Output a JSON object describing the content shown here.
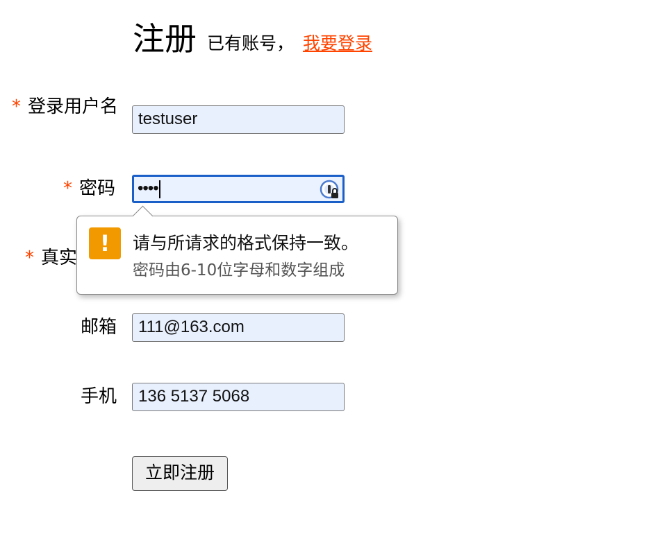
{
  "header": {
    "title": "注册",
    "subtitle": "已有账号，",
    "login_link": "我要登录"
  },
  "form": {
    "username_label": "登录用户名",
    "username_value": "testuser",
    "password_label": "密码",
    "password_value": "••••",
    "realname_label_partial": "真实",
    "email_label": "邮箱",
    "email_value": "111@163.com",
    "phone_label": "手机",
    "phone_value": "136 5137 5068",
    "required_mark": "*",
    "submit_label": "立即注册"
  },
  "validation_tooltip": {
    "icon_glyph": "!",
    "message": "请与所请求的格式保持一致。",
    "hint": "密码由6-10位字母和数字组成"
  },
  "colors": {
    "accent": "#ff4400",
    "focus_border": "#1a5fc8",
    "warning": "#f29900",
    "autofill_bg": "#e8f0fe"
  }
}
